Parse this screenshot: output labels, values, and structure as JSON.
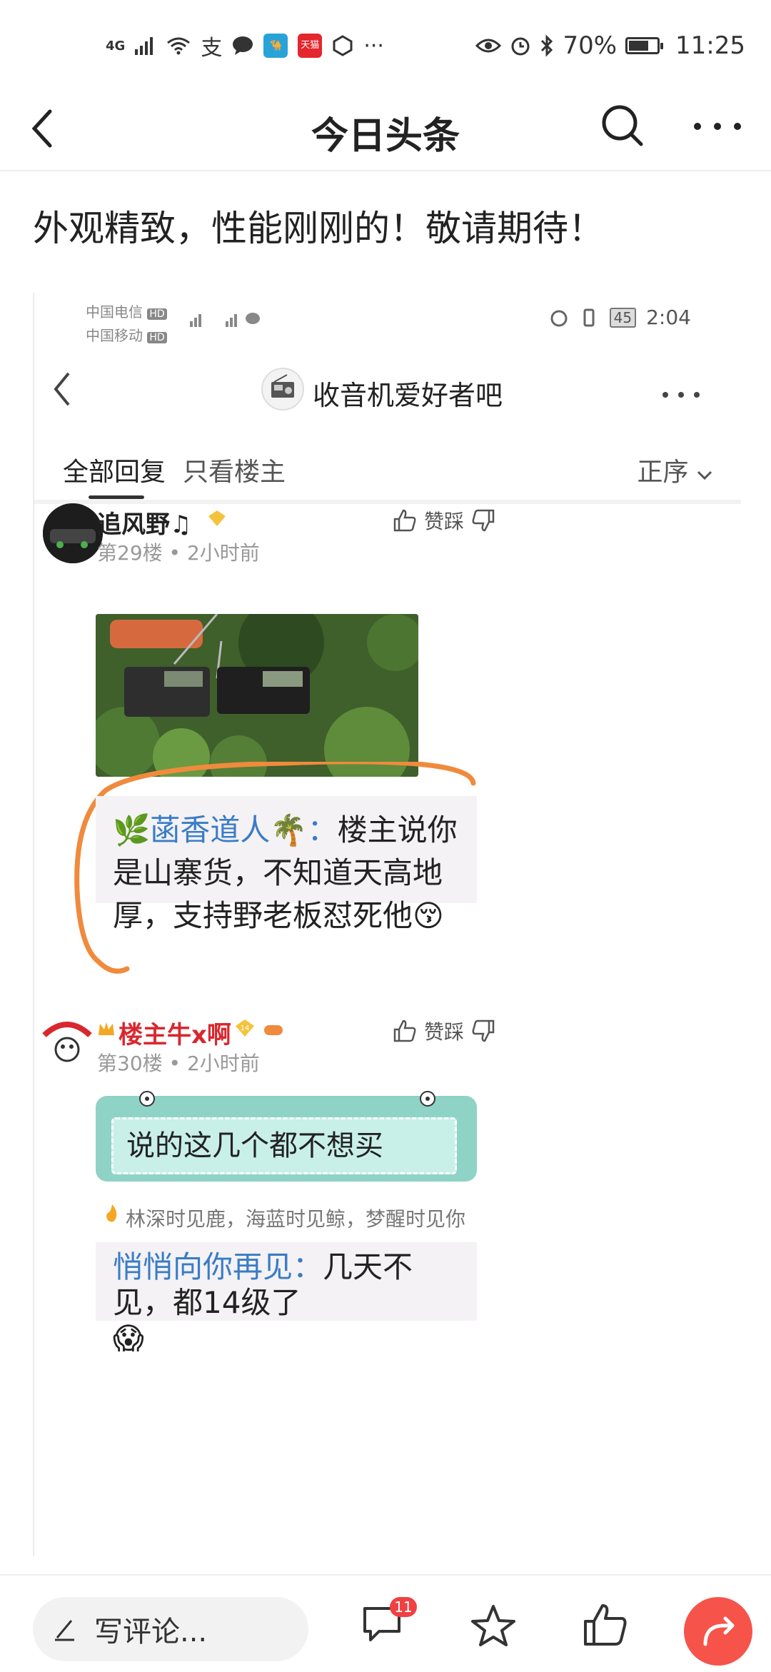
{
  "status_bar": {
    "left_network": "4G",
    "tmall_badge": "天猫",
    "more": "···",
    "battery": "70%",
    "battery_level": 0.7,
    "time": "11:25"
  },
  "nav": {
    "title": "今日头条"
  },
  "article": {
    "caption": "外观精致，性能刚刚的！敬请期待！"
  },
  "embedded": {
    "status_bar": {
      "carrier1": "中国电信",
      "carrier2": "中国移动",
      "hd": "HD",
      "battery": "45",
      "time": "2:04"
    },
    "forum_title": "收音机爱好者吧",
    "tabs": {
      "all": "全部回复",
      "owner": "只看楼主",
      "sort": "正序"
    },
    "posts": [
      {
        "username": "追风野♫",
        "floor": "第29楼",
        "dot": "•",
        "time": "2小时前",
        "like_label": "赞踩",
        "quote_name": "菡香道人",
        "quote_colon": "：",
        "quote_text": "楼主说你是山寨货，不知道天高地厚，支持野老板怼死他"
      },
      {
        "username": "楼主牛x啊",
        "floor": "第30楼",
        "dot": "•",
        "time": "2小时前",
        "level": "14",
        "like_label": "赞踩",
        "sticker_text": "说的这几个都不想买",
        "signature": "林深时见鹿，海蓝时见鲸，梦醒时见你",
        "quote_name": "悄悄向你再见",
        "quote_colon": "：",
        "quote_text": "几天不见，都14级了"
      }
    ]
  },
  "bottom_bar": {
    "comment_placeholder": "写评论...",
    "comment_count": "11"
  },
  "colors": {
    "accent_red": "#f04142",
    "share_button": "#f6544a",
    "quote_name_blue": "#3a7cc7",
    "owner_red": "#d9272e",
    "sticker_green": "#8fd2c6",
    "annotation_orange": "#f08a3c"
  }
}
